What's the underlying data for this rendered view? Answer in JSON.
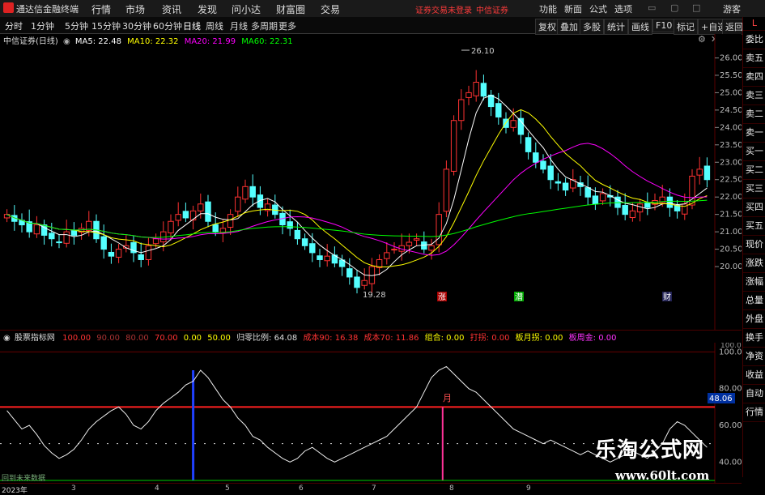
{
  "app": {
    "title": "通达信金融终端"
  },
  "menu": {
    "items": [
      "行情",
      "市场",
      "资讯",
      "发现",
      "问小达",
      "财富圈",
      "交易"
    ],
    "notice": "证券交易未登录",
    "broker": "中信证券",
    "right": [
      "功能",
      "新面",
      "公式",
      "选项"
    ],
    "guest": "游客"
  },
  "periods": [
    "分时",
    "1分钟",
    "5分钟",
    "15分钟",
    "30分钟",
    "60分钟",
    "日线",
    "周线",
    "月线",
    "多周期",
    "更多"
  ],
  "active_period": "日线",
  "toolbar": [
    "复权",
    "叠加",
    "多股",
    "统计",
    "画线",
    "F10",
    "标记",
    "+自选",
    "返回"
  ],
  "stock": {
    "name": "中信证券(日线)",
    "ma5": "MA5: 22.48",
    "ma10": "MA10: 22.32",
    "ma20": "MA20: 21.99",
    "ma60": "MA60: 22.31"
  },
  "price_axis": [
    "26.00",
    "25.50",
    "25.00",
    "24.50",
    "24.00",
    "23.50",
    "23.00",
    "22.50",
    "22.00",
    "21.50",
    "21.00",
    "20.50",
    "20.00"
  ],
  "annotations": {
    "high": "26.10",
    "low": "19.28"
  },
  "signals": {
    "zhang": "涨",
    "qian": "潜",
    "cai": "财"
  },
  "indicator": {
    "name": "股票指标网",
    "v100": "100.00",
    "v90": "90.00",
    "v80": "80.00",
    "v70": "70.00",
    "v0": "0.00",
    "v50": "50.00",
    "ratio_label": "归零比例: 64.08",
    "cost90": "成本90: 16.38",
    "cost70": "成本70: 11.86",
    "combo": "组合: 0.00",
    "da": "打拐: 0.00",
    "ban": "板月拐: 0.00",
    "ban2": "板周金: 0.00",
    "axis": [
      "100.00",
      "80.00",
      "60.00",
      "40.00"
    ],
    "current": "48.06",
    "month_mark": "月"
  },
  "side_panel": [
    "L",
    "委比",
    "卖五",
    "卖四",
    "卖三",
    "卖二",
    "卖一",
    "买一",
    "买二",
    "买三",
    "买四",
    "买五",
    "现价",
    "涨跌",
    "涨幅",
    "总量",
    "外盘",
    "换手",
    "净资",
    "收益",
    "自动",
    "行情"
  ],
  "timeline": {
    "year": "2023年",
    "months": [
      "3",
      "4",
      "5",
      "6",
      "7",
      "8",
      "9"
    ],
    "status": "回到未来数据"
  },
  "watermark": {
    "cn": "乐淘公式网",
    "url": "www.60lt.com"
  },
  "colors": {
    "up": "#ff3232",
    "down": "#54ffff",
    "ma5": "#ffffff",
    "ma10": "#ffff00",
    "ma20": "#ff00ff",
    "ma60": "#00ff00"
  },
  "chart_data": {
    "type": "candlestick",
    "title": "中信证券(日线)",
    "ylim": [
      19.0,
      26.5
    ],
    "closes": [
      21.5,
      21.3,
      21.2,
      21.0,
      21.2,
      20.9,
      20.8,
      20.7,
      21.0,
      20.9,
      21.1,
      21.3,
      20.8,
      20.5,
      20.3,
      20.5,
      20.6,
      20.4,
      20.2,
      20.6,
      20.8,
      21.0,
      21.3,
      21.5,
      21.4,
      21.6,
      21.8,
      21.3,
      21.0,
      21.1,
      21.5,
      22.0,
      22.3,
      22.0,
      21.7,
      21.8,
      21.5,
      21.2,
      21.1,
      20.8,
      20.6,
      20.4,
      20.2,
      20.3,
      20.1,
      20.0,
      19.7,
      19.4,
      19.6,
      20.0,
      20.2,
      20.4,
      20.5,
      20.6,
      20.7,
      20.8,
      20.5,
      20.6,
      21.5,
      22.8,
      24.2,
      24.8,
      25.0,
      25.3,
      24.9,
      24.6,
      24.3,
      24.0,
      24.2,
      23.8,
      23.3,
      23.0,
      22.8,
      22.5,
      22.4,
      22.2,
      22.5,
      22.3,
      22.0,
      21.8,
      22.1,
      22.0,
      21.7,
      21.5,
      21.6,
      21.8,
      21.7,
      21.9,
      22.0,
      21.7,
      21.6,
      21.8,
      22.6,
      22.8,
      22.5
    ],
    "indicator_values": [
      68,
      63,
      58,
      60,
      55,
      49,
      45,
      42,
      44,
      47,
      52,
      58,
      62,
      65,
      68,
      70,
      66,
      60,
      58,
      62,
      68,
      72,
      75,
      78,
      82,
      84,
      90,
      86,
      80,
      74,
      70,
      64,
      60,
      54,
      52,
      48,
      45,
      42,
      40,
      42,
      46,
      48,
      45,
      42,
      40,
      42,
      44,
      46,
      48,
      50,
      52,
      54,
      58,
      62,
      66,
      70,
      78,
      86,
      90,
      92,
      88,
      84,
      80,
      78,
      74,
      70,
      66,
      62,
      58,
      56,
      54,
      52,
      50,
      52,
      50,
      48,
      46,
      44,
      46,
      44,
      42,
      40,
      42,
      44,
      46,
      44,
      42,
      46,
      50,
      58,
      62,
      60,
      56,
      52,
      48
    ]
  }
}
